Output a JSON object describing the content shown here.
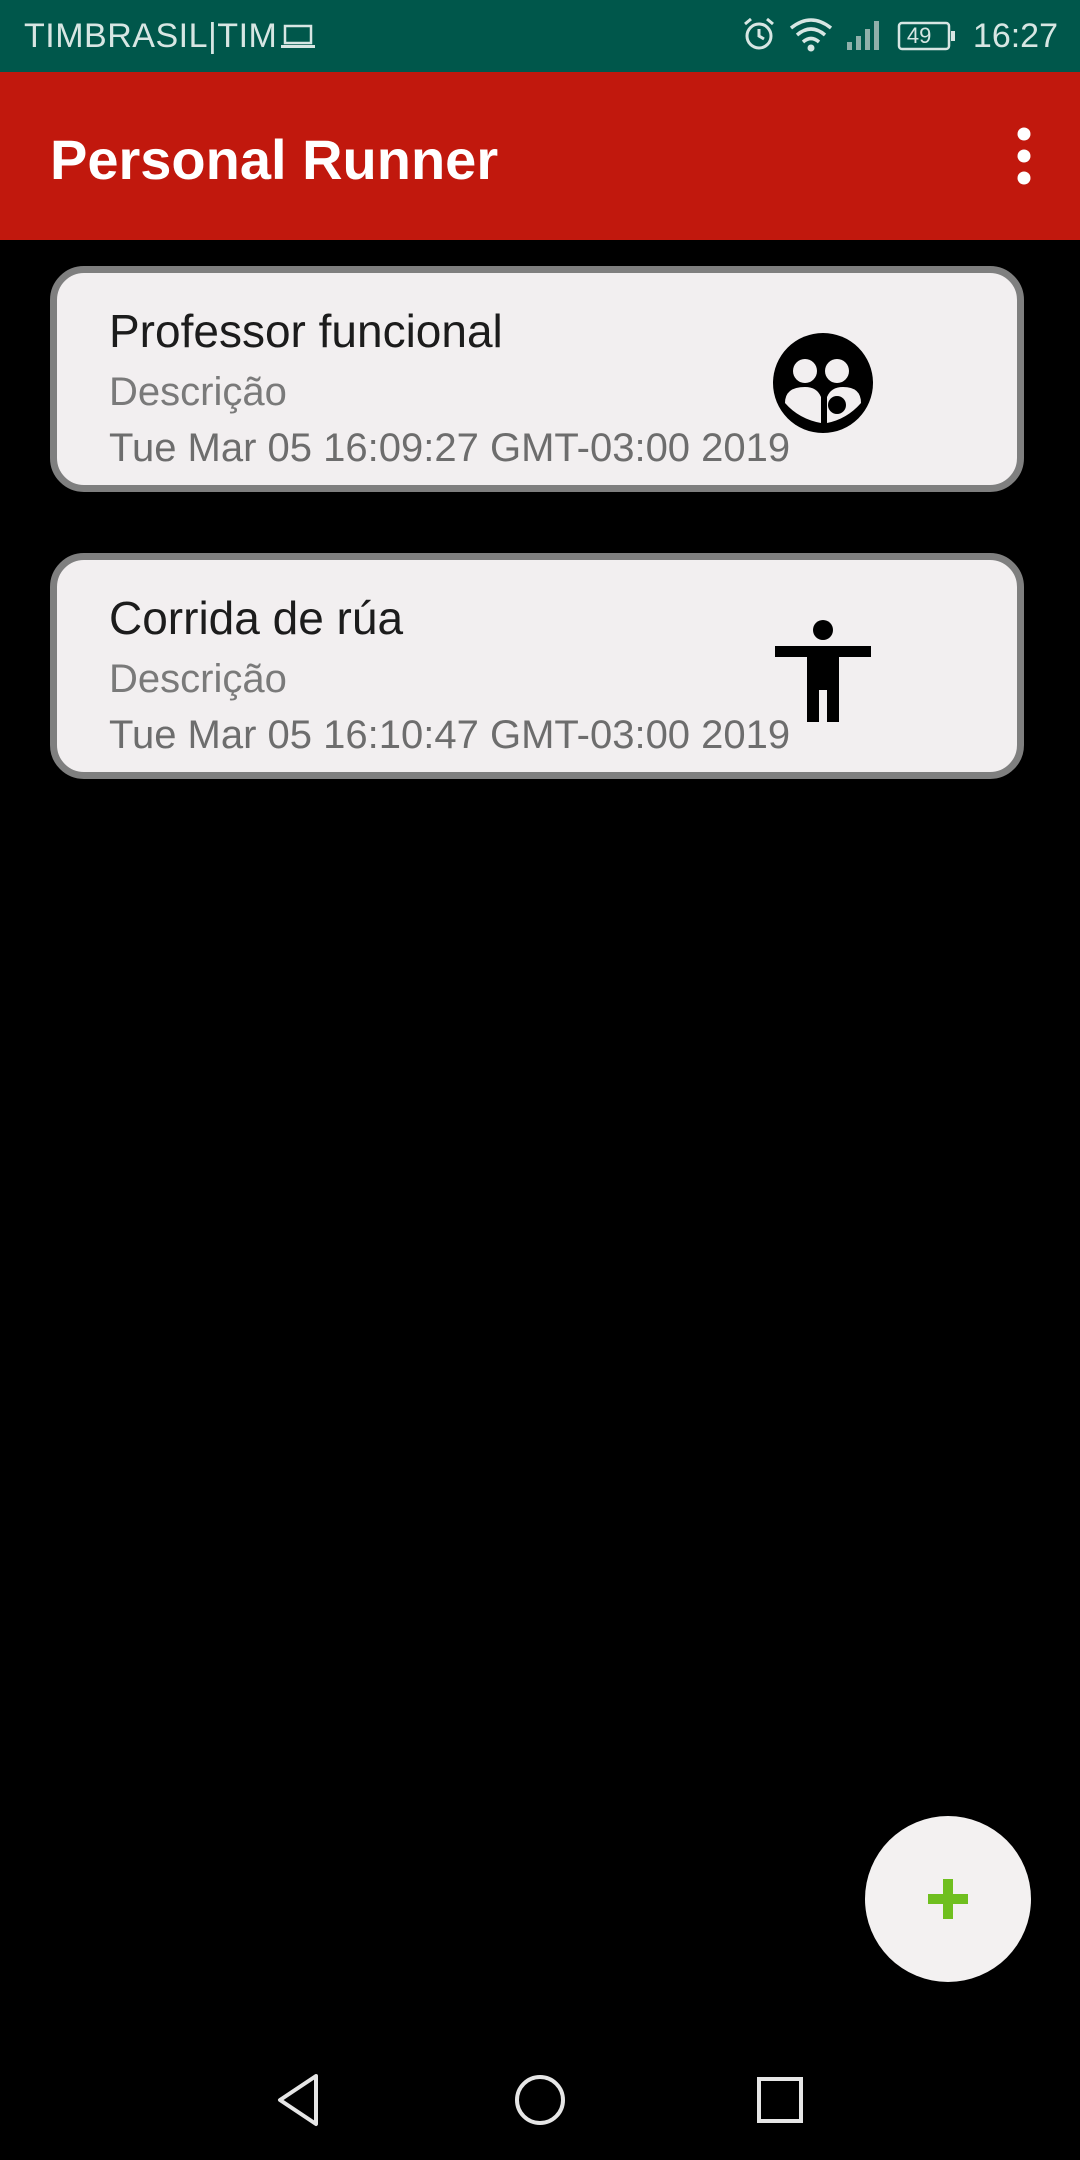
{
  "status_bar": {
    "carrier": "TIMBRASIL|TIM",
    "battery": "49",
    "time": "16:27",
    "background": "#00574b"
  },
  "app_bar": {
    "title": "Personal Runner",
    "background": "#c1180d",
    "menu_icon": "more-vert-icon"
  },
  "activities": [
    {
      "title": "Professor funcional",
      "description": "Descrição",
      "date": "Tue Mar 05 16:09:27 GMT-03:00 2019",
      "icon": "group-icon"
    },
    {
      "title": "Corrida de rúa",
      "description": "Descrição",
      "date": "Tue Mar 05 16:10:47 GMT-03:00 2019",
      "icon": "accessibility-icon"
    }
  ],
  "fab": {
    "icon": "plus-icon",
    "icon_color": "#6fbf1f"
  },
  "nav_bar": {
    "back_icon": "back-icon",
    "home_icon": "home-icon",
    "recents_icon": "recents-icon"
  }
}
